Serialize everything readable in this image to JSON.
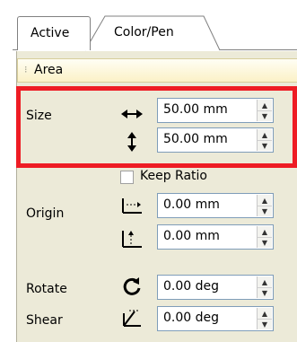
{
  "tabs": [
    {
      "label": "Active",
      "selected": true
    },
    {
      "label": "Color/Pen",
      "selected": false
    }
  ],
  "section": {
    "title": "Area"
  },
  "rows": {
    "size_label": "Size",
    "size_width": "50.00 mm",
    "size_height": "50.00 mm",
    "keep_ratio_label": "Keep Ratio",
    "keep_ratio_checked": false,
    "origin_label": "Origin",
    "origin_x": "0.00 mm",
    "origin_y": "0.00 mm",
    "rotate_label": "Rotate",
    "rotate_value": "0.00 deg",
    "shear_label": "Shear",
    "shear_value": "0.00 deg"
  },
  "icons": {
    "width": "horizontal-arrows-icon",
    "height": "vertical-arrows-icon",
    "origin_x": "origin-x-icon",
    "origin_y": "origin-y-icon",
    "rotate": "rotate-icon",
    "shear": "shear-icon",
    "spin": "spin-arrows-icon"
  },
  "colors": {
    "highlight": "#ee1c24",
    "panel": "#ecead8",
    "header": "#fbf1c7",
    "field_border": "#7f9db9"
  }
}
